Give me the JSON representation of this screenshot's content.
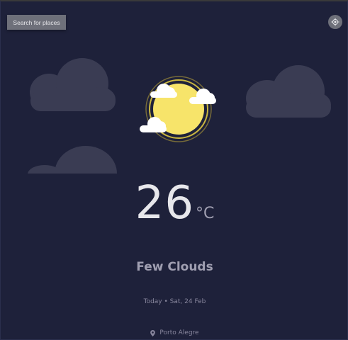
{
  "search": {
    "label": "Search for places"
  },
  "location_button": {
    "icon": "gps-target-icon"
  },
  "weather": {
    "temperature": "26",
    "unit": "°C",
    "condition": "Few Clouds",
    "icon": "sun-with-clouds-icon"
  },
  "date": {
    "today": "Today",
    "separator": "•",
    "value": "Sat, 24 Feb",
    "text": "Today • Sat, 24 Feb"
  },
  "location": {
    "icon": "map-pin-icon",
    "name": "Porto Alegre"
  },
  "colors": {
    "background": "#1e213a",
    "button": "#6e707a",
    "primary_text": "#e7e7eb",
    "secondary_text": "#a09fb1",
    "muted_text": "#88869d",
    "sun": "#f7e46a",
    "sun_ring": "#c9b640"
  }
}
